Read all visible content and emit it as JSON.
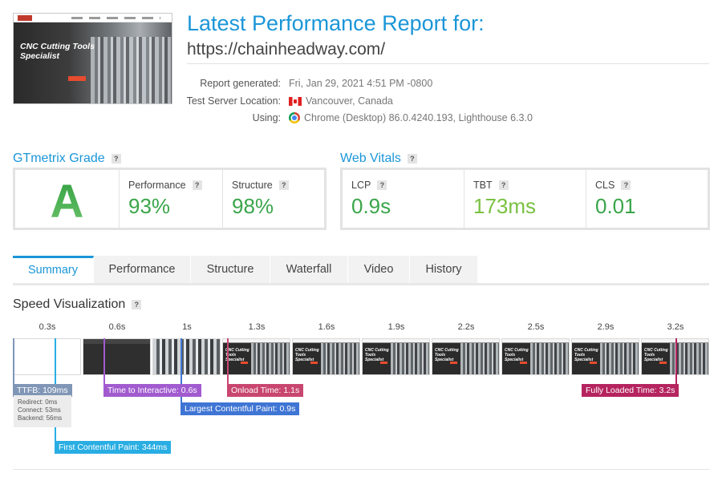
{
  "thumbnail": {
    "headline": "CNC Cutting Tools Specialist"
  },
  "header": {
    "title": "Latest Performance Report for:",
    "url": "https://chainheadway.com/"
  },
  "meta": [
    {
      "label": "Report generated:",
      "value": "Fri, Jan 29, 2021 4:51 PM -0800",
      "icon": ""
    },
    {
      "label": "Test Server Location:",
      "value": "Vancouver, Canada",
      "icon": "canada-flag-icon"
    },
    {
      "label": "Using:",
      "value": "Chrome (Desktop) 86.0.4240.193, Lighthouse 6.3.0",
      "icon": "chrome-icon"
    }
  ],
  "grade": {
    "heading": "GTmetrix Grade",
    "letter": "A",
    "performance_label": "Performance",
    "performance_value": "93%",
    "structure_label": "Structure",
    "structure_value": "98%"
  },
  "vitals": {
    "heading": "Web Vitals",
    "lcp_label": "LCP",
    "lcp_value": "0.9s",
    "tbt_label": "TBT",
    "tbt_value": "173ms",
    "cls_label": "CLS",
    "cls_value": "0.01"
  },
  "help_glyph": "?",
  "tabs": [
    "Summary",
    "Performance",
    "Structure",
    "Waterfall",
    "Video",
    "History"
  ],
  "active_tab": "Summary",
  "speed": {
    "heading": "Speed Visualization",
    "ticks": [
      "0.3s",
      "0.6s",
      "1s",
      "1.3s",
      "1.6s",
      "1.9s",
      "2.2s",
      "2.5s",
      "2.9s",
      "3.2s"
    ],
    "markers": {
      "ttfb": "TTFB: 109ms",
      "tti": "Time to Interactive: 0.6s",
      "onload": "Onload Time: 1.1s",
      "fully": "Fully Loaded Time: 3.2s",
      "lcp": "Largest Contentful Paint: 0.9s",
      "fcp": "First Contentful Paint: 344ms"
    },
    "ttfb_detail": [
      "Redirect: 0ms",
      "Connect: 53ms",
      "Backend: 56ms"
    ],
    "frame_headline": "CNC Cutting Tools Specialist"
  },
  "colors": {
    "accent": "#1b96d8",
    "good": "#3aa54a",
    "tbt": "#7ac143",
    "ttfb": "#8096b6",
    "tti": "#a15bcf",
    "onload": "#c8466f",
    "fully": "#b5245f",
    "lcp": "#3f75d4",
    "fcp": "#29aee3"
  }
}
